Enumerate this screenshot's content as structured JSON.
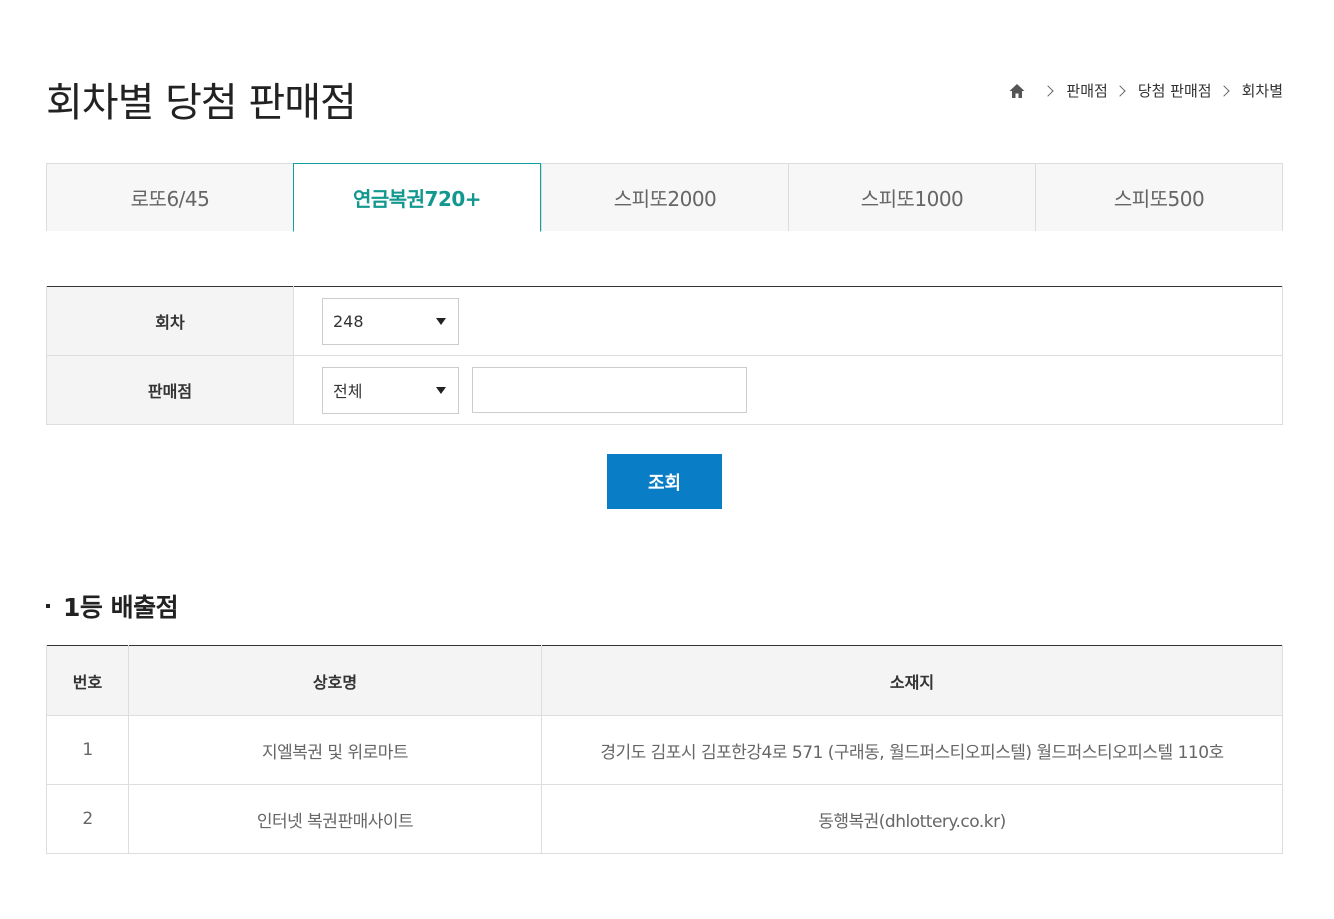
{
  "page": {
    "title": "회차별 당첨 판매점"
  },
  "breadcrumb": {
    "items": [
      "판매점",
      "당첨 판매점",
      "회차별"
    ]
  },
  "tabs": [
    {
      "label": "로또6/45",
      "active": false
    },
    {
      "label": "연금복권720+",
      "active": true
    },
    {
      "label": "스피또2000",
      "active": false
    },
    {
      "label": "스피또1000",
      "active": false
    },
    {
      "label": "스피또500",
      "active": false
    }
  ],
  "search": {
    "round_label": "회차",
    "round_value": "248",
    "store_label": "판매점",
    "store_value": "전체",
    "store_input_value": "",
    "button_label": "조회"
  },
  "section": {
    "title": "1등 배출점"
  },
  "table": {
    "headers": [
      "번호",
      "상호명",
      "소재지"
    ],
    "rows": [
      {
        "no": "1",
        "name": "지엘복권 및 위로마트",
        "address": "경기도 김포시 김포한강4로 571 (구래동, 월드퍼스티오피스텔) 월드퍼스티오피스텔 110호"
      },
      {
        "no": "2",
        "name": "인터넷 복권판매사이트",
        "address": "동행복권(dhlottery.co.kr)"
      }
    ]
  },
  "colors": {
    "accent_tab": "#13988f",
    "button": "#0a7dc7"
  },
  "icons": {
    "home": "home-icon",
    "chevron": "chevron-right-icon",
    "caret": "caret-down-icon"
  }
}
